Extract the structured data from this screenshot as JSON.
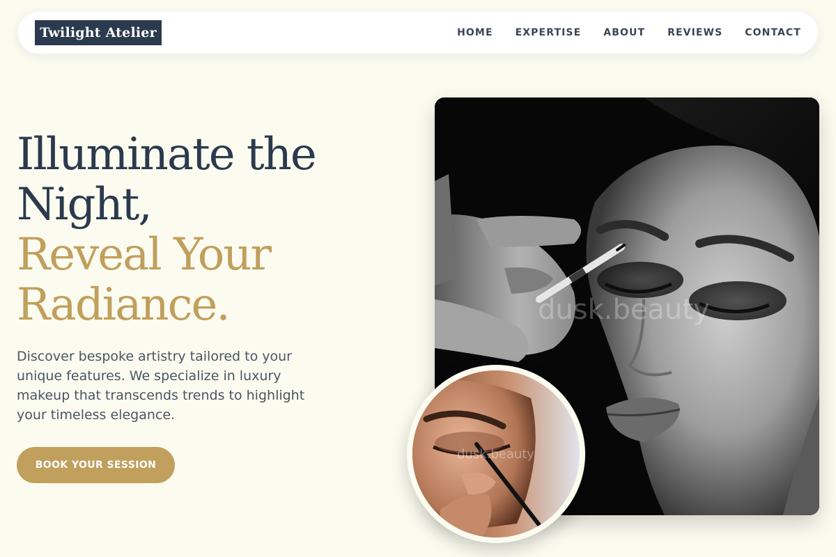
{
  "brand": {
    "name": "Twilight Atelier"
  },
  "nav": {
    "items": [
      "HOME",
      "EXPERTISE",
      "ABOUT",
      "REVIEWS",
      "CONTACT"
    ]
  },
  "hero": {
    "title_lines": [
      "Illuminate the",
      "Night,"
    ],
    "accent_lines": [
      "Reveal Your",
      "Radiance."
    ],
    "description": "Discover bespoke artistry tailored to your unique features. We specialize in luxury makeup that transcends trends to highlight your timeless elegance.",
    "cta_label": "BOOK YOUR SESSION"
  },
  "images": {
    "main_watermark": "dusk.beauty",
    "circle_watermark": "dusk.beauty"
  },
  "colors": {
    "background": "#fbfbf0",
    "navy": "#2b3a4d",
    "gold": "#c19f5c",
    "body_text": "#4a5564"
  }
}
